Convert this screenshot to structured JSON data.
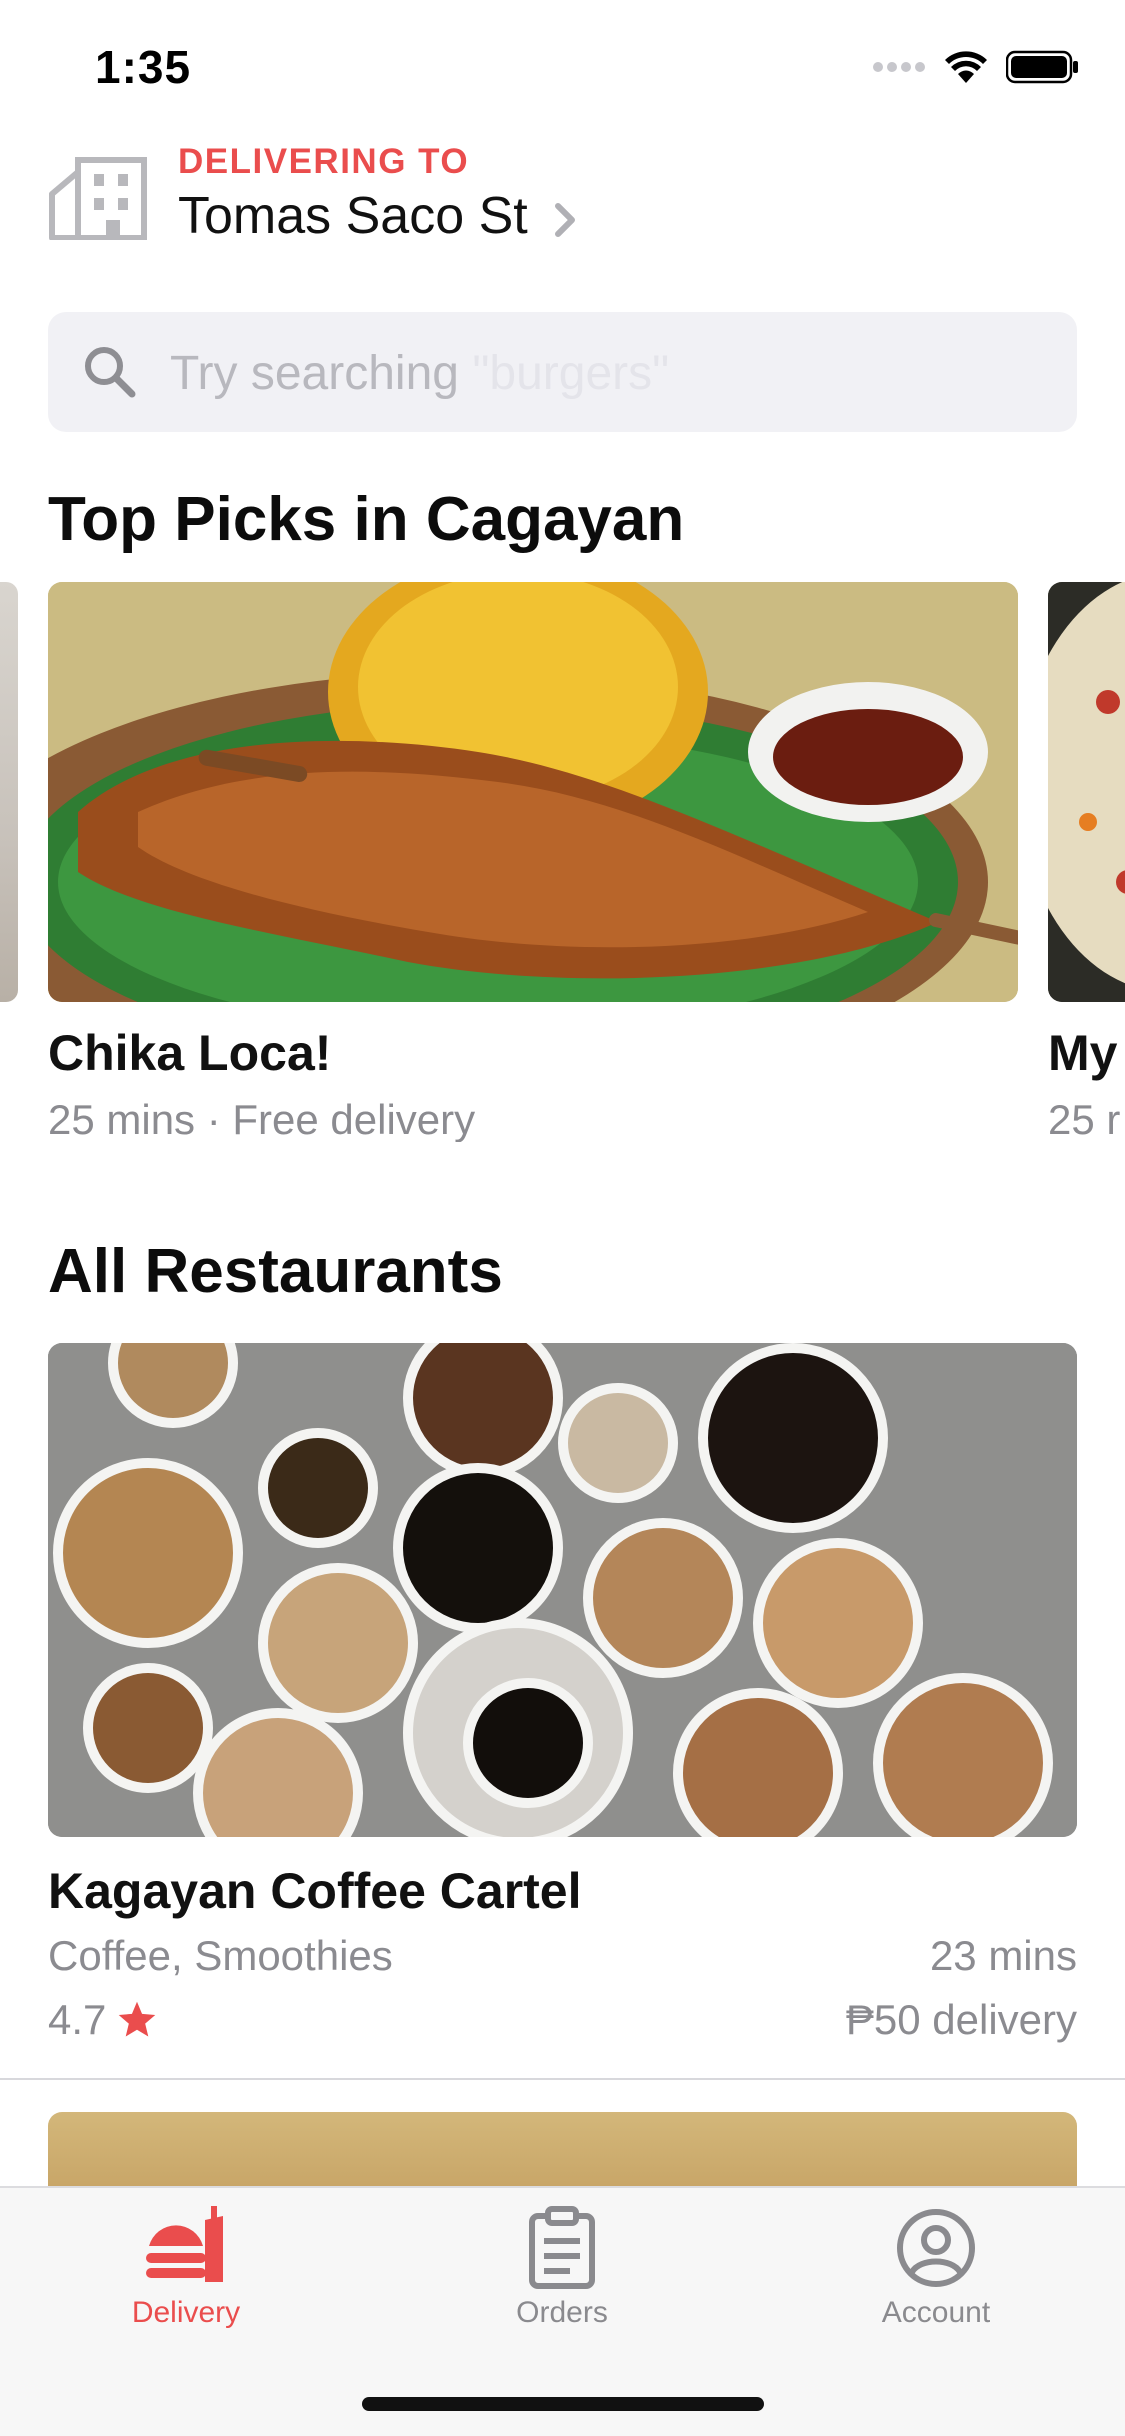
{
  "status_bar": {
    "time": "1:35",
    "icons": [
      "signal-icon",
      "wifi-icon",
      "battery-icon"
    ]
  },
  "header": {
    "label": "DELIVERING TO",
    "address": "Tomas Saco St",
    "icon": "building-icon"
  },
  "search": {
    "placeholder_prefix": "Try searching",
    "placeholder_suffix": "\"burgers\""
  },
  "top_picks": {
    "title": "Top Picks in Cagayan",
    "cards": [
      {
        "name": "Chika Loca!",
        "meta": "25 mins · Free delivery"
      },
      {
        "name": "My",
        "meta": "25 r"
      }
    ]
  },
  "all_restaurants": {
    "title": "All Restaurants",
    "items": [
      {
        "name": "Kagayan Coffee Cartel",
        "cuisine": "Coffee, Smoothies",
        "time": "23 mins",
        "rating": "4.7",
        "fee": "₱50 delivery"
      }
    ]
  },
  "tabbar": {
    "tabs": [
      {
        "label": "Delivery",
        "icon": "delivery-icon",
        "active": true
      },
      {
        "label": "Orders",
        "icon": "clipboard-icon",
        "active": false
      },
      {
        "label": "Account",
        "icon": "account-icon",
        "active": false
      }
    ]
  },
  "colors": {
    "accent": "#ea4d4d",
    "muted_text": "#8b8b90",
    "search_bg": "#f1f1f5"
  }
}
